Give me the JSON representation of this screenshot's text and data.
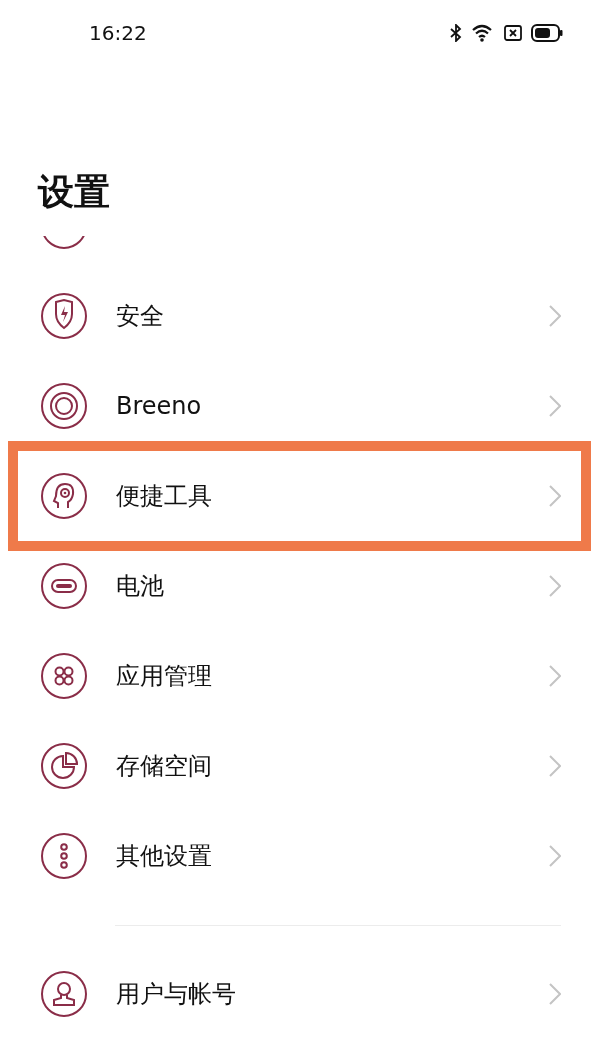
{
  "status_bar": {
    "time": "16:22"
  },
  "title": "设置",
  "items": [
    {
      "kind": "partial",
      "highlighted": false
    },
    {
      "kind": "shield",
      "label": "安全",
      "highlighted": false
    },
    {
      "kind": "rings",
      "label": "Breeno",
      "highlighted": false
    },
    {
      "kind": "head",
      "label": "便捷工具",
      "highlighted": true
    },
    {
      "kind": "battery",
      "label": "电池",
      "highlighted": false
    },
    {
      "kind": "apps",
      "label": "应用管理",
      "highlighted": false
    },
    {
      "kind": "pie",
      "label": "存储空间",
      "highlighted": false
    },
    {
      "kind": "dots",
      "label": "其他设置",
      "highlighted": false
    },
    {
      "kind": "divider"
    },
    {
      "kind": "user",
      "label": "用户与帐号",
      "highlighted": false
    }
  ]
}
